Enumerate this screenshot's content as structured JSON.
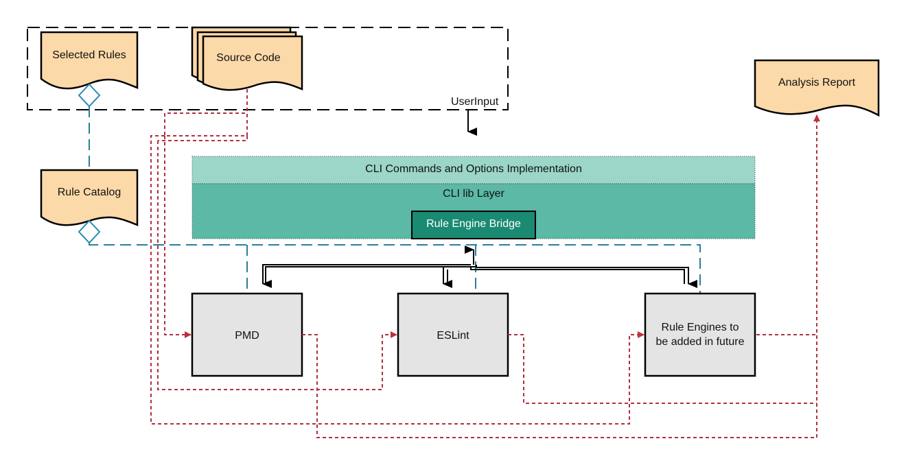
{
  "nodes": {
    "selected_rules": "Selected Rules",
    "source_code": "Source Code",
    "user_input_group": "UserInput",
    "analysis_report": "Analysis Report",
    "rule_catalog": "Rule Catalog",
    "cli_commands": "CLI Commands and Options Implementation",
    "cli_lib": "CLI lib Layer",
    "rule_engine_bridge": "Rule Engine Bridge",
    "pmd": "PMD",
    "eslint": "ESLint",
    "future_engines": [
      "Rule Engines to",
      "be added in future"
    ]
  },
  "colors": {
    "document_fill": "#fcd9a8",
    "cli_commands_fill": "#9bd6c9",
    "cli_lib_fill": "#5bb9a5",
    "bridge_fill": "#1a8a72",
    "engine_fill": "#e4e4e4",
    "data_flow": "#b03040",
    "rule_link": "#2a7d9a"
  }
}
